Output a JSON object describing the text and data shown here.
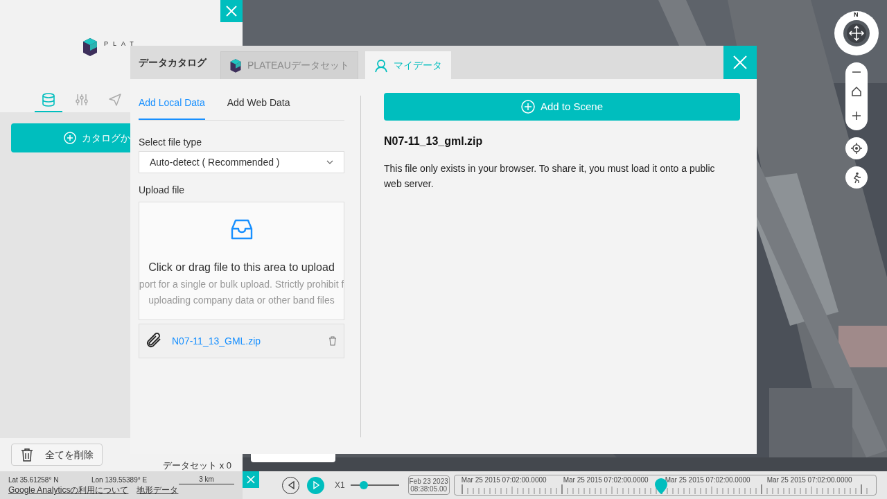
{
  "sidebar": {
    "logo": "PLAT",
    "tabs": [
      {
        "kind": "database",
        "selected": true
      },
      {
        "kind": "sliders",
        "selected": false
      },
      {
        "kind": "send",
        "selected": false
      }
    ],
    "catalog_button": "カタログか",
    "clear_button": "全てを削除",
    "dataset_count": "データセット x 0"
  },
  "status": {
    "lat": "Lat  35.61258° N",
    "lon": "Lon  139.55389° E",
    "scale": "3 km",
    "links": [
      "Google Analyticsの利用について",
      "地形データ"
    ]
  },
  "modal": {
    "title": "データカタログ",
    "tabs": [
      {
        "label": "PLATEAUデータセット",
        "kind": "plateau",
        "selected": false
      },
      {
        "label": "マイデータ",
        "kind": "user",
        "selected": true
      }
    ],
    "subtabs": [
      {
        "label": "Add Local Data",
        "selected": true
      },
      {
        "label": "Add Web Data",
        "selected": false
      }
    ],
    "file_type_label": "Select file type",
    "file_type_value": "Auto-detect ( Recommended )",
    "upload_label": "Upload file",
    "dropzone": {
      "title": "Click or drag file to this area to upload",
      "hints": [
        "port for a single or bulk upload. Strictly prohibit f",
        "uploading company data or other band files"
      ]
    },
    "file": "N07-11_13_GML.zip",
    "add_button": "Add to Scene",
    "file_name": "N07-11_13_gml.zip",
    "description": "This file only exists in your browser. To share it, you must load it onto a public web server."
  },
  "compass": {
    "north": "N"
  },
  "timeline": {
    "speed": {
      "label": "X1",
      "level": 0.27
    },
    "current_date": "Feb 23 2023",
    "current_time": "08:38:05.00",
    "labels": [
      "Mar 25 2015 07:02:00.0000",
      "Mar 25 2015 07:02:00.0000",
      "Mar 25 2015 07:02:00.0000",
      "Mar 25 2015 07:02:00.0000"
    ],
    "level": 0.49
  }
}
